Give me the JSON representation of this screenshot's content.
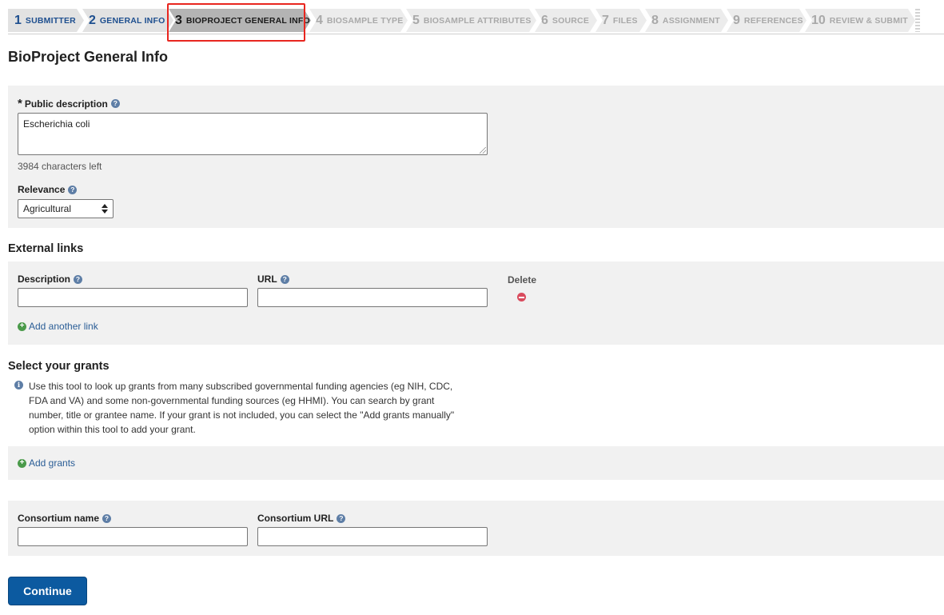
{
  "steps": [
    {
      "num": "1",
      "label": "SUBMITTER",
      "state": "done"
    },
    {
      "num": "2",
      "label": "GENERAL INFO",
      "state": "done"
    },
    {
      "num": "3",
      "label": "BIOPROJECT GENERAL INFO",
      "state": "current"
    },
    {
      "num": "4",
      "label": "BIOSAMPLE TYPE",
      "state": "future"
    },
    {
      "num": "5",
      "label": "BIOSAMPLE ATTRIBUTES",
      "state": "future"
    },
    {
      "num": "6",
      "label": "SOURCE",
      "state": "future"
    },
    {
      "num": "7",
      "label": "FILES",
      "state": "future"
    },
    {
      "num": "8",
      "label": "ASSIGNMENT",
      "state": "future"
    },
    {
      "num": "9",
      "label": "REFERENCES",
      "state": "future"
    },
    {
      "num": "10",
      "label": "REVIEW & SUBMIT",
      "state": "future"
    }
  ],
  "page_title": "BioProject General Info",
  "description_section": {
    "required_marker": "*",
    "label": "Public description",
    "help_icon": "?",
    "value": "Escherichia coli",
    "chars_left": "3984 characters left",
    "relevance_label": "Relevance",
    "relevance_value": "Agricultural"
  },
  "external_links": {
    "heading": "External links",
    "description_label": "Description",
    "url_label": "URL",
    "delete_label": "Delete",
    "description_value": "",
    "url_value": "",
    "add_link": "Add another link",
    "plus_icon": "+"
  },
  "grants": {
    "heading": "Select your grants",
    "info_icon": "i",
    "info_text": "Use this tool to look up grants from many subscribed governmental funding agencies (eg NIH, CDC, FDA and VA) and some non-governmental funding sources (eg HHMI). You can search by grant number, title or grantee name. If your grant is not included, you can select the \"Add grants manually\" option within this tool to add your grant.",
    "add_grants": "Add grants"
  },
  "consortium": {
    "name_label": "Consortium name",
    "url_label": "Consortium URL",
    "name_value": "",
    "url_value": ""
  },
  "continue_label": "Continue",
  "colors": {
    "accent": "#0c5aa0",
    "link": "#2a5d96",
    "highlight": "#e8261f",
    "delete": "#d94b5d",
    "add": "#4a9a4a"
  }
}
